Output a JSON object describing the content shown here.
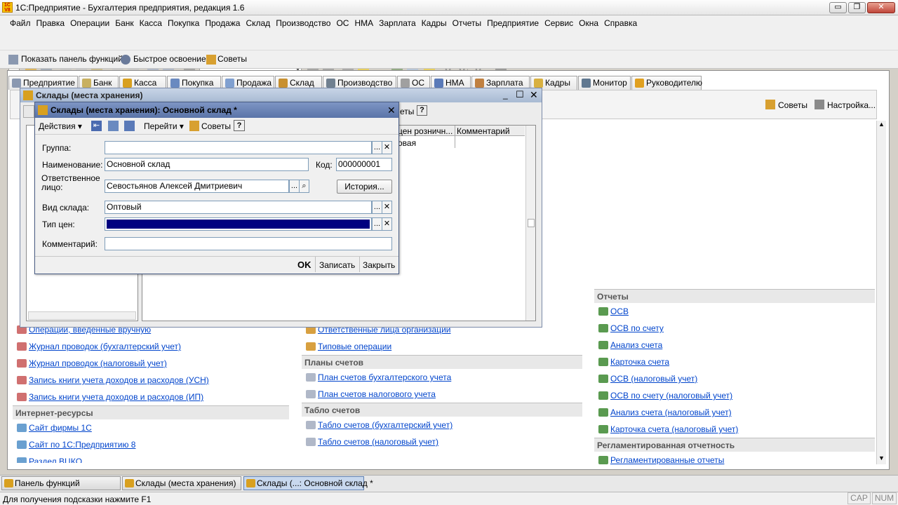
{
  "app": {
    "title": "1С:Предприятие - Бухгалтерия предприятия, редакция 1.6",
    "icon_text": "1C V8"
  },
  "window_controls": {
    "minimize": "▭",
    "restore": "❐",
    "close": "✕"
  },
  "menu": [
    "Файл",
    "Правка",
    "Операции",
    "Банк",
    "Касса",
    "Покупка",
    "Продажа",
    "Склад",
    "Производство",
    "ОС",
    "НМА",
    "Зарплата",
    "Кадры",
    "Отчеты",
    "Предприятие",
    "Сервис",
    "Окна",
    "Справка"
  ],
  "toolbar": {
    "m1": "M",
    "m2": "M+",
    "m3": "M-"
  },
  "bar2": {
    "show_panel": "Показать панель функций",
    "quick_start": "Быстрое освоение",
    "tips": "Советы"
  },
  "tabs": [
    "Предприятие",
    "Банк",
    "Касса",
    "Покупка",
    "Продажа",
    "Склад",
    "Производство",
    "ОС",
    "НМА",
    "Зарплата",
    "Кадры",
    "Монитор",
    "Руководителю"
  ],
  "panel_top": {
    "tips": "Советы",
    "settings": "Настройка..."
  },
  "left_column": {
    "items_top": [
      "Операции, введенные вручную",
      "Журнал проводок (бухгалтерский учет)",
      "Журнал проводок (налоговый учет)",
      "Запись книги учета доходов и расходов (УСН)",
      "Запись книги учета доходов и расходов (ИП)"
    ],
    "internet_header": "Интернет-ресурсы",
    "internet": [
      "Сайт фирмы 1С",
      "Сайт по 1С:Предприятию 8",
      "Раздел ВЦКО"
    ]
  },
  "mid_column": {
    "items_top": [
      "Ответственные лица организации",
      "Типовые операции"
    ],
    "plans_header": "Планы счетов",
    "plans": [
      "План счетов бухгалтерского учета",
      "План счетов налогового учета"
    ],
    "tablo_header": "Табло счетов",
    "tablo": [
      "Табло счетов (бухгалтерский учет)",
      "Табло счетов (налоговый учет)"
    ]
  },
  "right_column": {
    "reports_header": "Отчеты",
    "reports": [
      "ОСВ",
      "ОСВ по счету",
      "Анализ счета",
      "Карточка счета",
      "ОСВ (налоговый учет)",
      "ОСВ по счету (налоговый учет)",
      "Анализ счета (налоговый учет)",
      "Карточка счета (налоговый учет)"
    ],
    "reg_header": "Регламентированная отчетность",
    "reg": [
      "Регламентированные отчеты"
    ]
  },
  "list_window": {
    "title": "Склады (места хранения)",
    "toolbar_left": "Де",
    "toolbar_right": "еты",
    "help": "?",
    "columns": [
      "цен розничн...",
      "Комментарий"
    ],
    "row": [
      "овая",
      ""
    ]
  },
  "form": {
    "title": "Склады (места хранения): Основной склад *",
    "actions": "Действия",
    "goto": "Перейти",
    "tips": "Советы",
    "help": "?",
    "group_label": "Группа:",
    "group_value": "",
    "name_label": "Наименование:",
    "name_value": "Основной склад",
    "code_label": "Код:",
    "code_value": "000000001",
    "resp_label": "Ответственное лицо:",
    "resp_value": "Севостьянов  Алексей Дмитриевич",
    "history_button": "История...",
    "kind_label": "Вид склада:",
    "kind_value": "Оптовый",
    "price_label": "Тип цен:",
    "price_value": "",
    "comment_label": "Комментарий:",
    "comment_value": "",
    "ok": "OK",
    "save": "Записать",
    "close": "Закрыть"
  },
  "taskbar": [
    "Панель функций",
    "Склады (места хранения)",
    "Склады (...: Основной склад *"
  ],
  "status": {
    "hint": "Для получения подсказки нажмите F1",
    "cap": "CAP",
    "num": "NUM"
  },
  "colors": {
    "accent": "#000080",
    "link": "#0044cc",
    "selection": "#000080"
  }
}
